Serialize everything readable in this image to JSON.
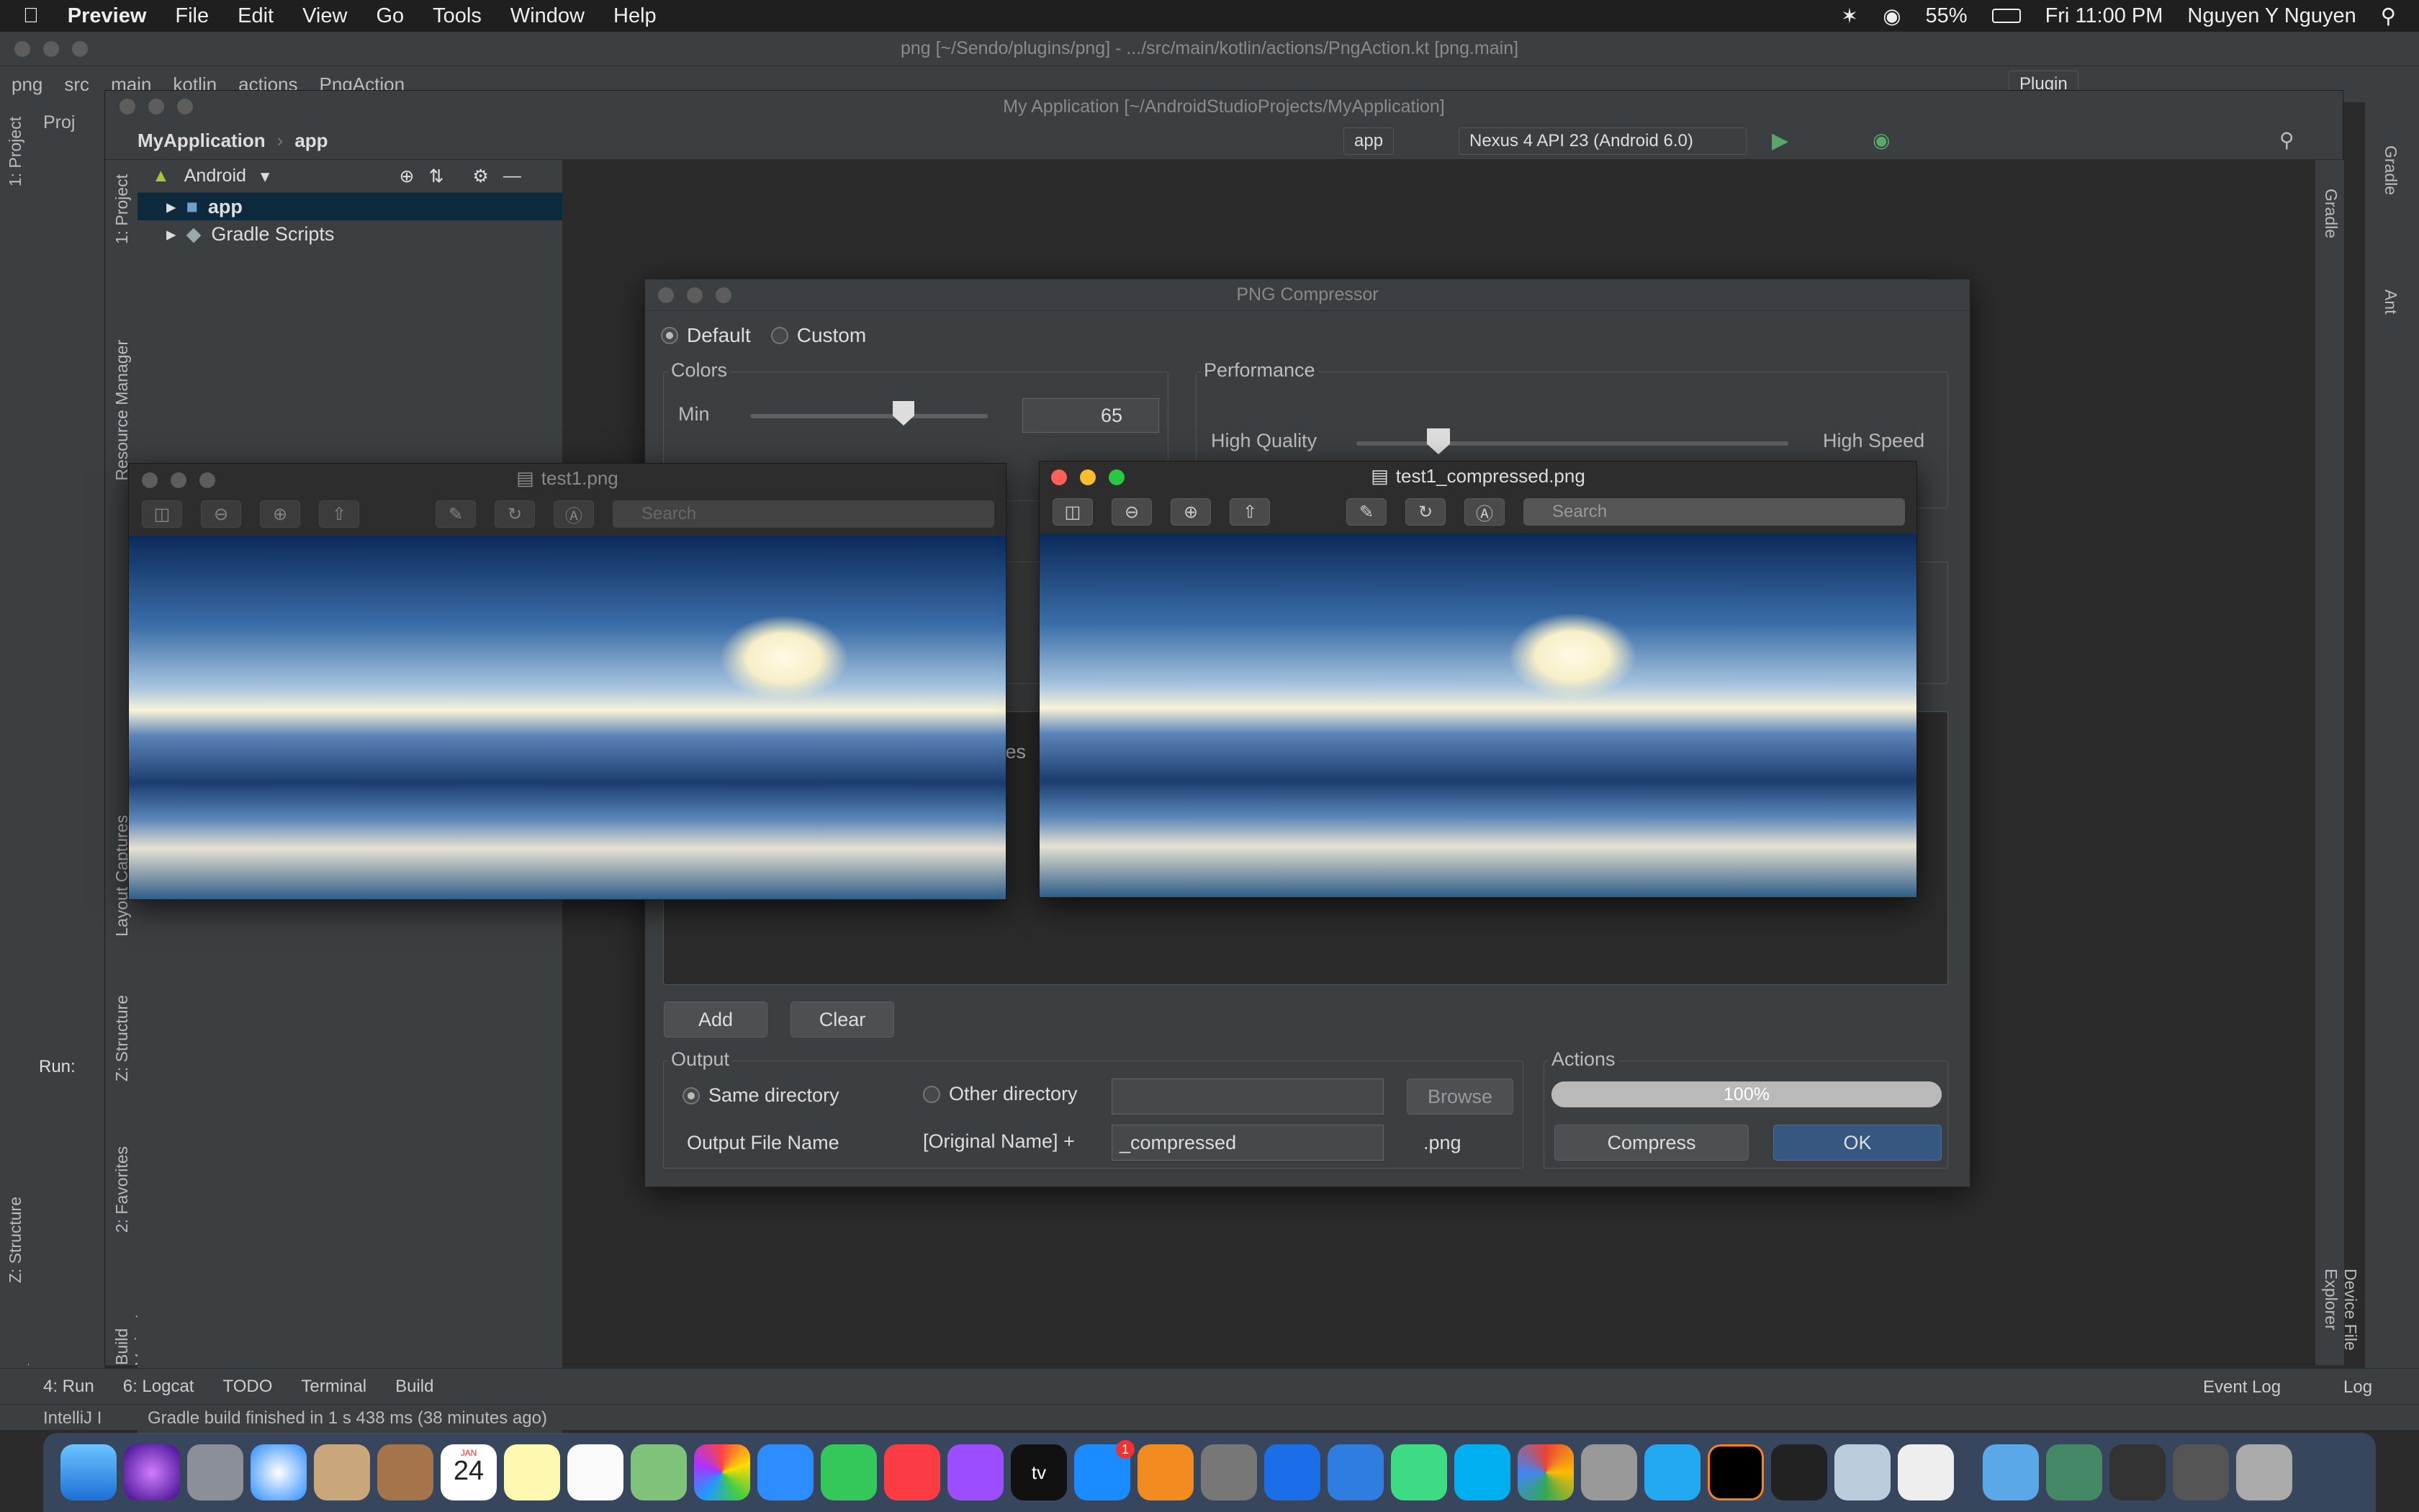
{
  "menubar": {
    "app": "Preview",
    "items": [
      "File",
      "Edit",
      "View",
      "Go",
      "Tools",
      "Window",
      "Help"
    ],
    "battery": "55%",
    "clock": "Fri 11:00 PM",
    "user": "Nguyen Y Nguyen"
  },
  "back_ide": {
    "title": "png [~/Sendo/plugins/png] - .../src/main/kotlin/actions/PngAction.kt [png.main]",
    "breadcrumbs": [
      "png",
      "src",
      "main",
      "kotlin",
      "actions",
      "PngAction"
    ],
    "run_config": "Plugin",
    "left_tabs": [
      "1: Project",
      "Z: Structure",
      "2: Favorites"
    ],
    "run_label": "Run:",
    "project_label": "Proj"
  },
  "front_ide": {
    "title": "My Application [~/AndroidStudioProjects/MyApplication]",
    "breadcrumbs": [
      "MyApplication",
      "app"
    ],
    "module": "app",
    "device": "Nexus 4 API 23 (Android 6.0)",
    "view_mode": "Android",
    "tree": [
      "app",
      "Gradle Scripts"
    ],
    "left_tabs": [
      "1: Project",
      "Resource Manager",
      "Layout Captures",
      "Z: Structure",
      "2: Favorites",
      "Build Variants"
    ],
    "right_tabs": [
      "Gradle",
      "Device File Explorer"
    ]
  },
  "far_right_tabs": [
    "Gradle",
    "Ant"
  ],
  "dialog": {
    "title": "PNG Compressor",
    "mode_default": "Default",
    "mode_custom": "Custom",
    "colors_label": "Colors",
    "min_label": "Min",
    "min_value": "65",
    "performance_label": "Performance",
    "high_quality": "High Quality",
    "high_speed": "High Speed",
    "partial_text": "Des",
    "add": "Add",
    "clear": "Clear",
    "output_label": "Output",
    "same_dir": "Same directory",
    "other_dir": "Other directory",
    "browse": "Browse",
    "output_file_name": "Output File Name",
    "original_name": "[Original Name] +",
    "suffix": "_compressed",
    "ext": ".png",
    "actions_label": "Actions",
    "progress": "100%",
    "compress": "Compress",
    "ok": "OK"
  },
  "preview1": {
    "title": "test1.png",
    "search_placeholder": "Search"
  },
  "preview2": {
    "title": "test1_compressed.png",
    "search_placeholder": "Search"
  },
  "bottom_tabs": [
    "4: Run",
    "6: Logcat",
    "TODO",
    "Terminal",
    "Build"
  ],
  "event_log": "Event Log",
  "log_label": "Log",
  "status_prefix": "IntelliJ I",
  "status": "Gradle build finished in 1 s 438 ms (38 minutes ago)",
  "dock_date": "24",
  "dock_month": "JAN",
  "dock_badge": "1",
  "dock_tv": "tv"
}
